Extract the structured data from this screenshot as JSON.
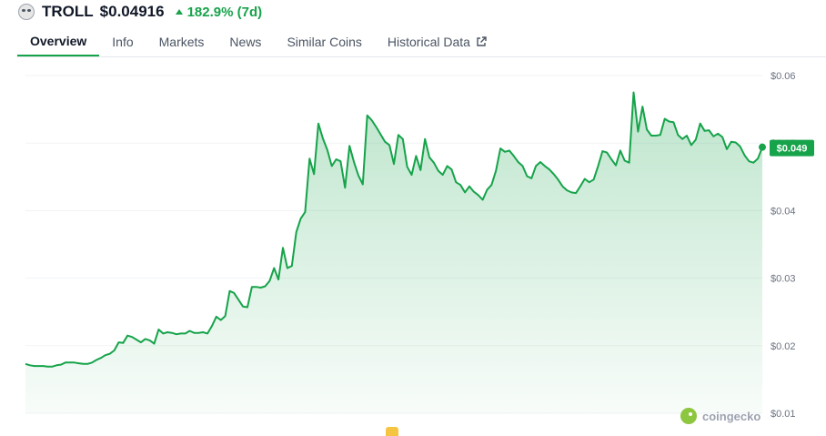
{
  "header": {
    "coin_logo_icon": "troll-face-icon",
    "name": "TROLL",
    "price": "$0.04916",
    "change": "182.9% (7d)",
    "change_color": "#16a34a"
  },
  "tabs": [
    {
      "label": "Overview",
      "active": true
    },
    {
      "label": "Info"
    },
    {
      "label": "Markets"
    },
    {
      "label": "News"
    },
    {
      "label": "Similar Coins"
    },
    {
      "label": "Historical Data",
      "icon": "external-link-icon"
    }
  ],
  "chart_data": {
    "type": "area",
    "title": "",
    "xlabel": "",
    "ylabel": "",
    "y_tick_labels": [
      "$0.06",
      "$0.05",
      "$0.04",
      "$0.03",
      "$0.02",
      "$0.01"
    ],
    "y_ticks": [
      0.06,
      0.05,
      0.04,
      0.03,
      0.02,
      0.01
    ],
    "ylim": [
      0.01,
      0.06
    ],
    "grid": true,
    "line_color": "#16a34a",
    "current_price_label": "$0.049",
    "series": [
      {
        "values": [
          0.0173,
          0.0171,
          0.017,
          0.017,
          0.017,
          0.0169,
          0.0169,
          0.0171,
          0.0172,
          0.0175,
          0.0175,
          0.0175,
          0.0174,
          0.0173,
          0.0173,
          0.0175,
          0.0179,
          0.0182,
          0.0186,
          0.0188,
          0.0193,
          0.0205,
          0.0204,
          0.0215,
          0.0213,
          0.0209,
          0.0205,
          0.021,
          0.0208,
          0.0203,
          0.0224,
          0.0218,
          0.022,
          0.0219,
          0.0217,
          0.0218,
          0.0218,
          0.0222,
          0.0219,
          0.0219,
          0.022,
          0.0218,
          0.0229,
          0.0243,
          0.0238,
          0.0244,
          0.0281,
          0.0278,
          0.0268,
          0.0258,
          0.0257,
          0.0287,
          0.0287,
          0.0286,
          0.0288,
          0.0296,
          0.0315,
          0.0298,
          0.0345,
          0.0315,
          0.0318,
          0.0368,
          0.0388,
          0.0398,
          0.0477,
          0.0454,
          0.0529,
          0.0507,
          0.049,
          0.0466,
          0.0476,
          0.0473,
          0.0434,
          0.0496,
          0.0472,
          0.0452,
          0.0439,
          0.0541,
          0.0534,
          0.0524,
          0.0513,
          0.0502,
          0.0497,
          0.0469,
          0.0512,
          0.0506,
          0.0465,
          0.0453,
          0.0481,
          0.046,
          0.0506,
          0.0479,
          0.0471,
          0.0459,
          0.0453,
          0.0466,
          0.0461,
          0.0442,
          0.0438,
          0.0427,
          0.0436,
          0.0428,
          0.0423,
          0.0416,
          0.0431,
          0.0438,
          0.0459,
          0.0492,
          0.0487,
          0.0489,
          0.0481,
          0.0472,
          0.0466,
          0.0451,
          0.0448,
          0.0466,
          0.0472,
          0.0466,
          0.0461,
          0.0454,
          0.0446,
          0.0436,
          0.043,
          0.0427,
          0.0426,
          0.0436,
          0.0447,
          0.0442,
          0.0446,
          0.0466,
          0.0488,
          0.0486,
          0.0476,
          0.0467,
          0.0489,
          0.0474,
          0.0471,
          0.0575,
          0.0517,
          0.0554,
          0.052,
          0.0511,
          0.0511,
          0.0512,
          0.0536,
          0.0532,
          0.0531,
          0.0512,
          0.0506,
          0.0511,
          0.0497,
          0.0505,
          0.0529,
          0.0518,
          0.0519,
          0.051,
          0.0514,
          0.0509,
          0.0491,
          0.0502,
          0.0501,
          0.0495,
          0.0482,
          0.0473,
          0.0471,
          0.0477,
          0.0494
        ]
      }
    ]
  },
  "watermark": {
    "icon": "coingecko-logo-icon",
    "text": "coingecko"
  }
}
